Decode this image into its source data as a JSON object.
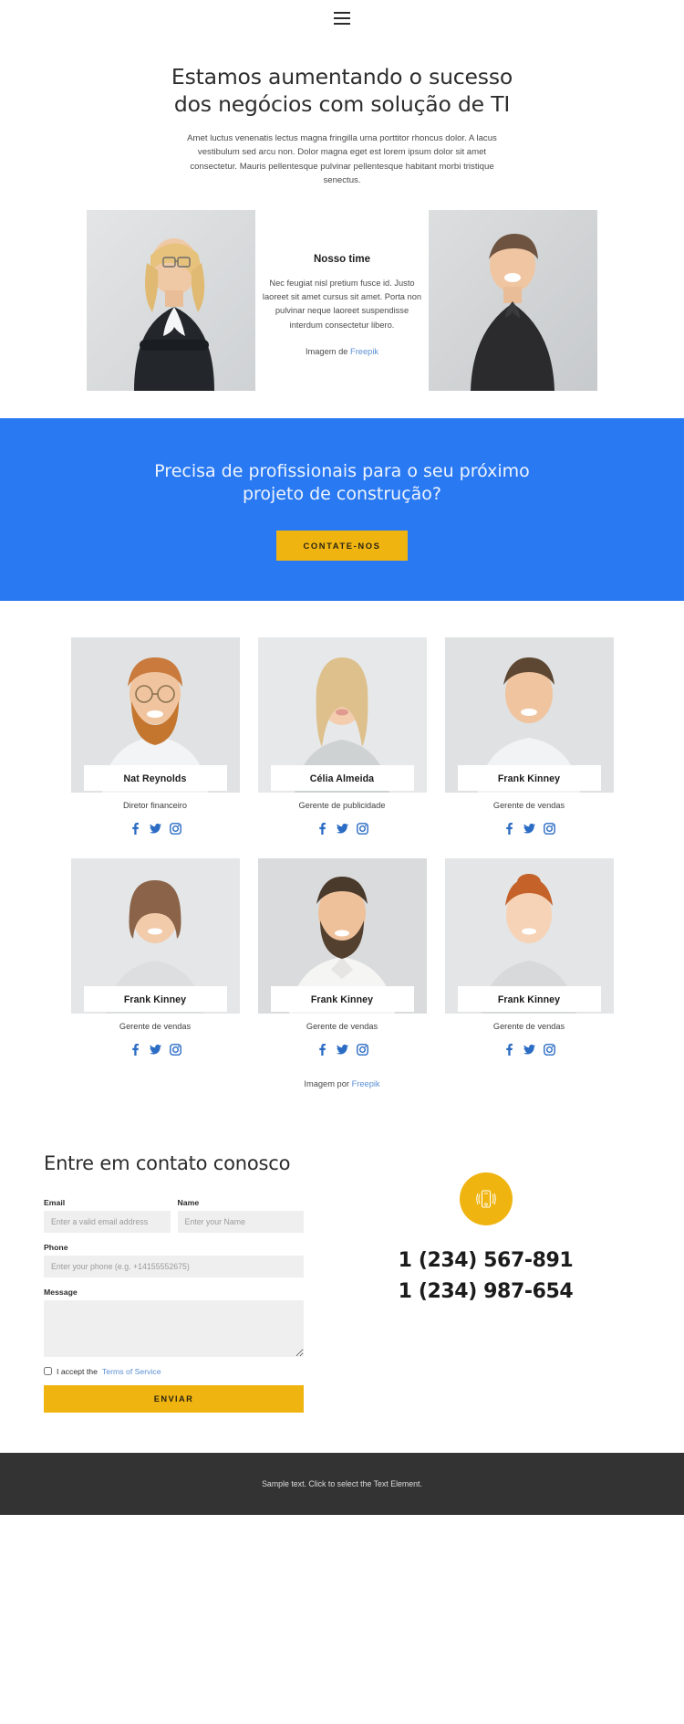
{
  "header": {
    "menu_icon": "hamburger-menu-icon"
  },
  "hero": {
    "title_line1": "Estamos aumentando o sucesso",
    "title_line2": "dos negócios com solução de TI",
    "paragraph": "Amet luctus venenatis lectus magna fringilla urna porttitor rhoncus dolor. A lacus vestibulum sed arcu non. Dolor magna eget est lorem ipsum dolor sit amet consectetur. Mauris pellentesque pulvinar pellentesque habitant morbi tristique senectus."
  },
  "intro": {
    "heading": "Nosso time",
    "paragraph": "Nec feugiat nisl pretium fusce id. Justo laoreet sit amet cursus sit amet. Porta non pulvinar neque laoreet suspendisse interdum consectetur libero.",
    "credit_prefix": "Imagem de ",
    "credit_link": "Freepik",
    "left_photo_alt": "businesswoman-portrait",
    "right_photo_alt": "young-man-portrait"
  },
  "cta": {
    "title_line1": "Precisa de profissionais para o seu próximo",
    "title_line2": "projeto de construção?",
    "button_label": "CONTATE-NOS",
    "background_color": "#2979f2",
    "button_color": "#f0b411"
  },
  "team": {
    "members": [
      {
        "name": "Nat Reynolds",
        "role": "Diretor financeiro",
        "photo": "bearded-man-glasses"
      },
      {
        "name": "Célia Almeida",
        "role": "Gerente de publicidade",
        "photo": "blonde-woman"
      },
      {
        "name": "Frank Kinney",
        "role": "Gerente de vendas",
        "photo": "young-man-white-tshirt"
      },
      {
        "name": "Frank Kinney",
        "role": "Gerente de vendas",
        "photo": "short-hair-woman"
      },
      {
        "name": "Frank Kinney",
        "role": "Gerente de vendas",
        "photo": "bearded-man-shirt"
      },
      {
        "name": "Frank Kinney",
        "role": "Gerente de vendas",
        "photo": "redhead-woman"
      }
    ],
    "social_icons": [
      "facebook-icon",
      "twitter-icon",
      "instagram-icon"
    ],
    "social_color": "#2b6cc4",
    "credit_prefix": "Imagem por ",
    "credit_link": "Freepik"
  },
  "contact": {
    "heading": "Entre em contato conosco",
    "fields": {
      "email_label": "Email",
      "email_placeholder": "Enter a valid email address",
      "email_value": "",
      "name_label": "Name",
      "name_placeholder": "Enter your Name",
      "name_value": "",
      "phone_label": "Phone",
      "phone_placeholder": "Enter your phone (e.g. +14155552675)",
      "phone_value": "",
      "message_label": "Message",
      "message_placeholder": "",
      "message_value": ""
    },
    "accept_text": "I accept the ",
    "terms_link": "Terms of Service",
    "submit_label": "ENVIAR",
    "phone_icon": "mobile-phone-ringing-icon",
    "phone_primary": "1 (234) 567-891",
    "phone_secondary": "1 (234) 987-654"
  },
  "footer": {
    "text": "Sample text. Click to select the Text Element."
  }
}
